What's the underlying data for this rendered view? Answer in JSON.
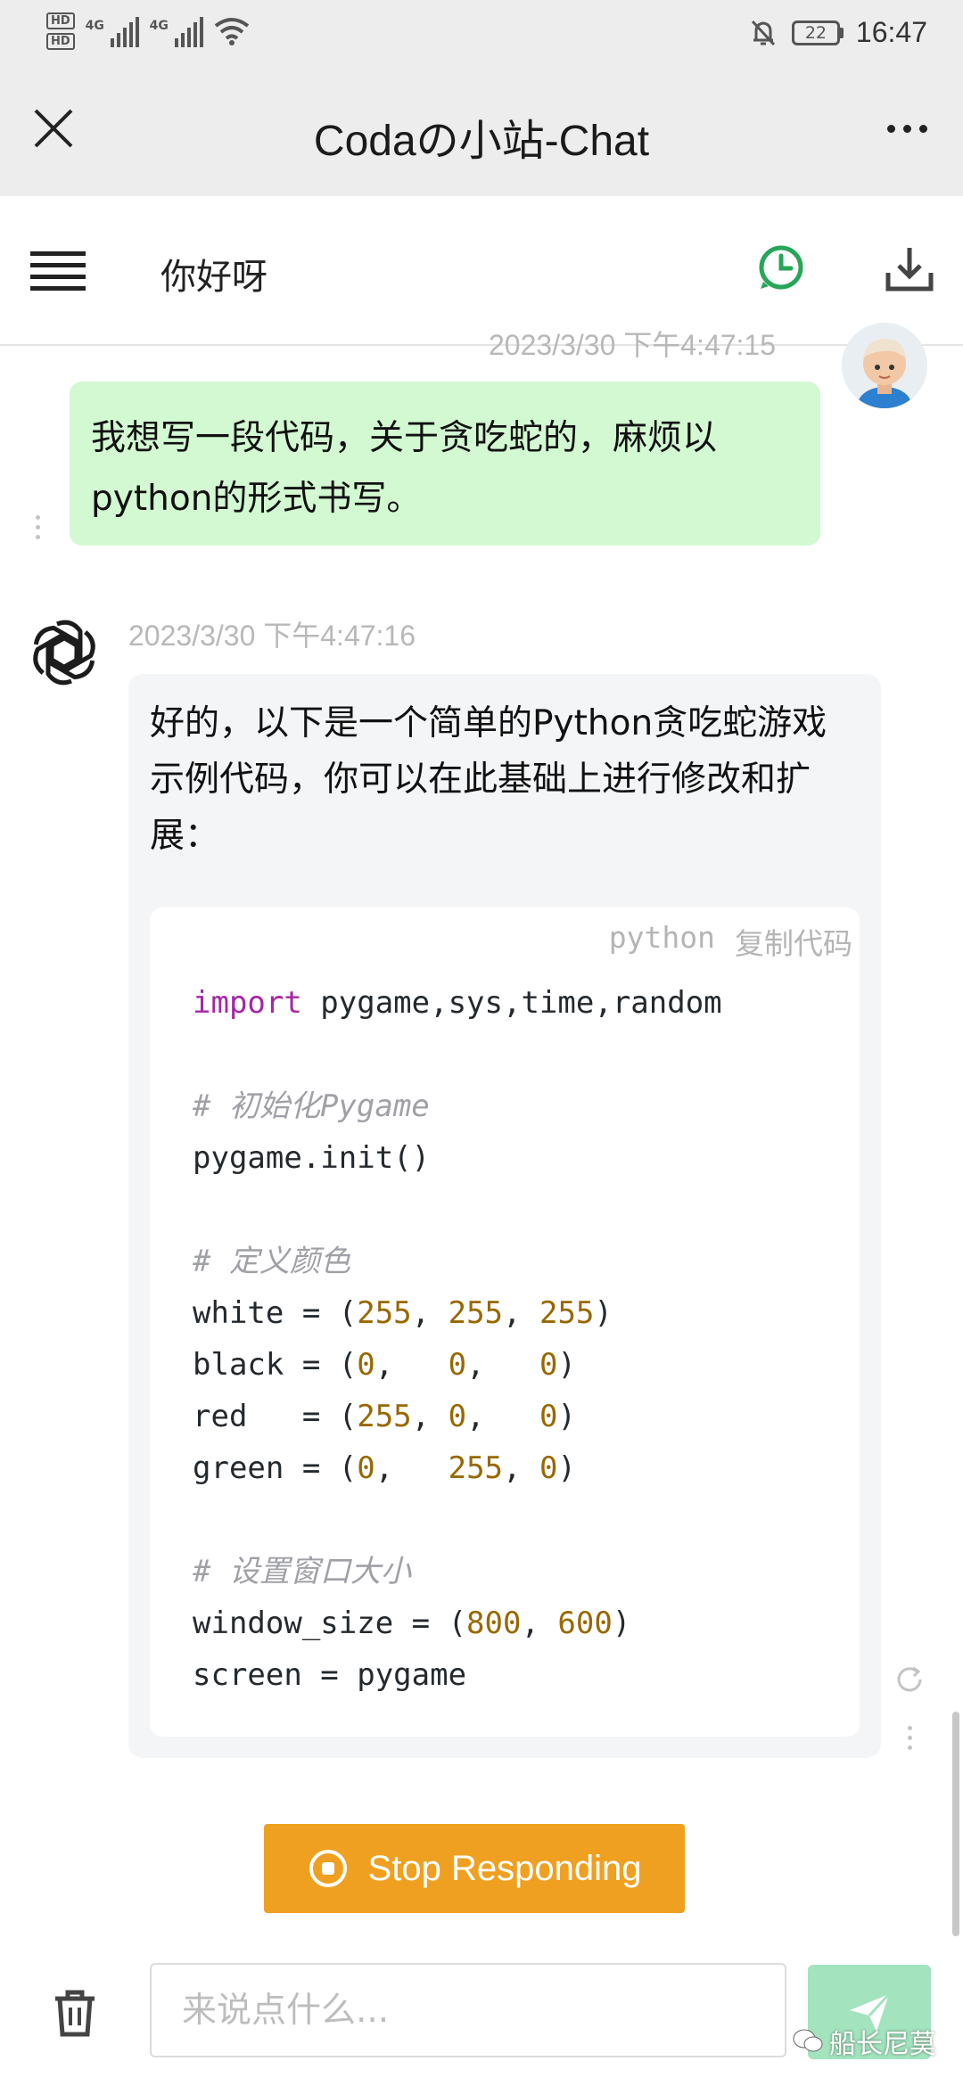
{
  "status_bar": {
    "time": "16:47",
    "battery": "22",
    "network_1": "4G",
    "network_2": "4G",
    "hd_1": "HD",
    "hd_2": "HD"
  },
  "title_bar": {
    "title": "Codaの小站-Chat",
    "close_icon": "close-icon",
    "more_icon": "more-icon"
  },
  "chat_header": {
    "name": "你好呀",
    "history_icon": "history-icon",
    "download_icon": "download-icon",
    "menu_icon": "menu-icon"
  },
  "messages": [
    {
      "role": "user",
      "time": "2023/3/30 下午4:47:15",
      "text": "我想写一段代码，关于贪吃蛇的，麻烦以python的形式书写。"
    },
    {
      "role": "assistant",
      "time": "2023/3/30 下午4:47:16",
      "text": "好的，以下是一个简单的Python贪吃蛇游戏示例代码，你可以在此基础上进行修改和扩展：",
      "code": {
        "language": "python",
        "copy_label": "复制代码",
        "lines": [
          "import pygame,sys,time,random",
          "",
          "# 初始化Pygame",
          "pygame.init()",
          "",
          "# 定义颜色",
          "white = (255, 255, 255)",
          "black = (0,   0,   0)",
          "red   = (255, 0,   0)",
          "green = (0,   255, 0)",
          "",
          "# 设置窗口大小",
          "window_size = (800, 600)",
          "screen = pygame"
        ]
      }
    }
  ],
  "stop_button": {
    "label": "Stop Responding"
  },
  "composer": {
    "placeholder": "来说点什么..."
  },
  "watermark": "船长尼莫",
  "colors": {
    "user_bubble": "#d2f9d1",
    "bot_bubble": "#f4f5f7",
    "stop_button": "#f0a020",
    "send_button": "#a3e3be",
    "history_icon": "#27a659"
  }
}
